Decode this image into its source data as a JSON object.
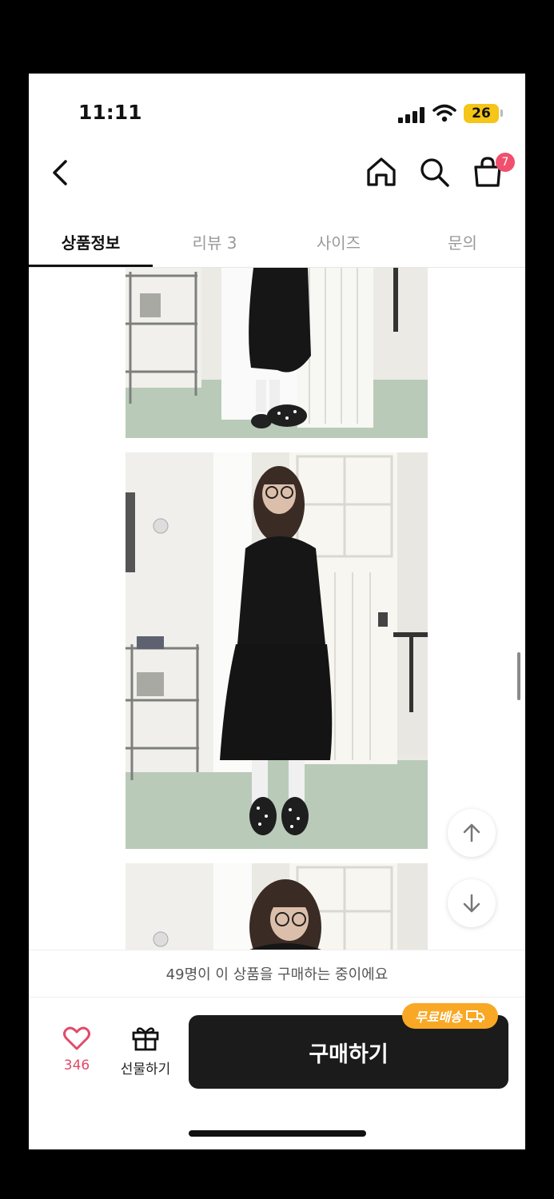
{
  "status_bar": {
    "time": "11:11",
    "battery": "26"
  },
  "header": {
    "cart_count": "7"
  },
  "tabs": [
    {
      "label": "상품정보",
      "active": true
    },
    {
      "label": "리뷰 3",
      "active": false
    },
    {
      "label": "사이즈",
      "active": false
    },
    {
      "label": "문의",
      "active": false
    }
  ],
  "footer": {
    "notice": "49명이 이 상품을 구매하는 중이에요",
    "like_count": "346",
    "gift_label": "선물하기",
    "buy_label": "구매하기",
    "free_shipping_badge": "무료배송"
  },
  "colors": {
    "accent": "#f0506e",
    "badge_orange": "#f9a825",
    "buy_bg": "#1b1b1b"
  }
}
